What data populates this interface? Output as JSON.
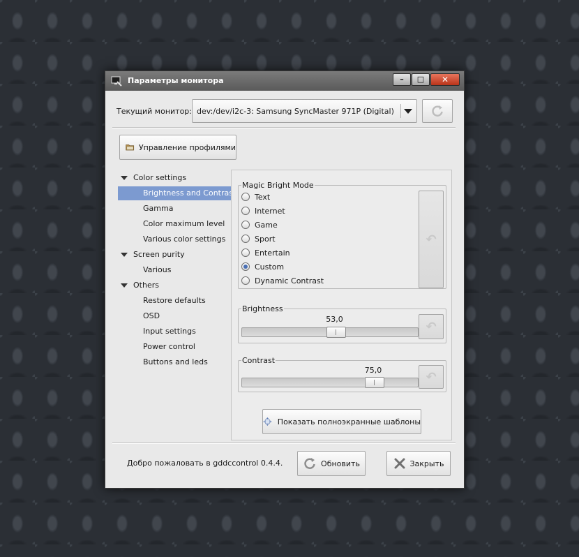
{
  "window": {
    "title": "Параметры монитора",
    "controls": {
      "minimize": "–",
      "maximize": "□",
      "close": "✕"
    }
  },
  "monitor": {
    "label": "Текущий монитор:",
    "selected": "dev:/dev/i2c-3: Samsung SyncMaster 971P (Digital)"
  },
  "toolbar": {
    "profiles_label": "Управление профилями"
  },
  "tree": {
    "color_settings": "Color settings",
    "brightness_contrast": "Brightness and Contrast",
    "gamma": "Gamma",
    "color_max": "Color maximum level",
    "various_color": "Various color settings",
    "screen_purity": "Screen purity",
    "various": "Various",
    "others": "Others",
    "restore": "Restore defaults",
    "osd": "OSD",
    "input": "Input settings",
    "power": "Power control",
    "buttons": "Buttons and leds"
  },
  "magic_bright": {
    "title": "Magic Bright Mode",
    "options": [
      "Text",
      "Internet",
      "Game",
      "Sport",
      "Entertain",
      "Custom",
      "Dynamic Contrast"
    ],
    "selected": "Custom"
  },
  "brightness": {
    "title": "Brightness",
    "value_text": "53,0",
    "value": 53,
    "max": 100
  },
  "contrast": {
    "title": "Contrast",
    "value_text": "75,0",
    "value": 75,
    "max": 100
  },
  "templates_label": "Показать полноэкранные шаблоны",
  "status": "Добро пожаловать в gddccontrol 0.4.4.",
  "footer": {
    "refresh_label": "Обновить",
    "close_label": "Закрыть"
  },
  "colors": {
    "selection": "#7c9ad0",
    "titlebar": "#6a6a6a",
    "close_button": "#c9452a"
  }
}
